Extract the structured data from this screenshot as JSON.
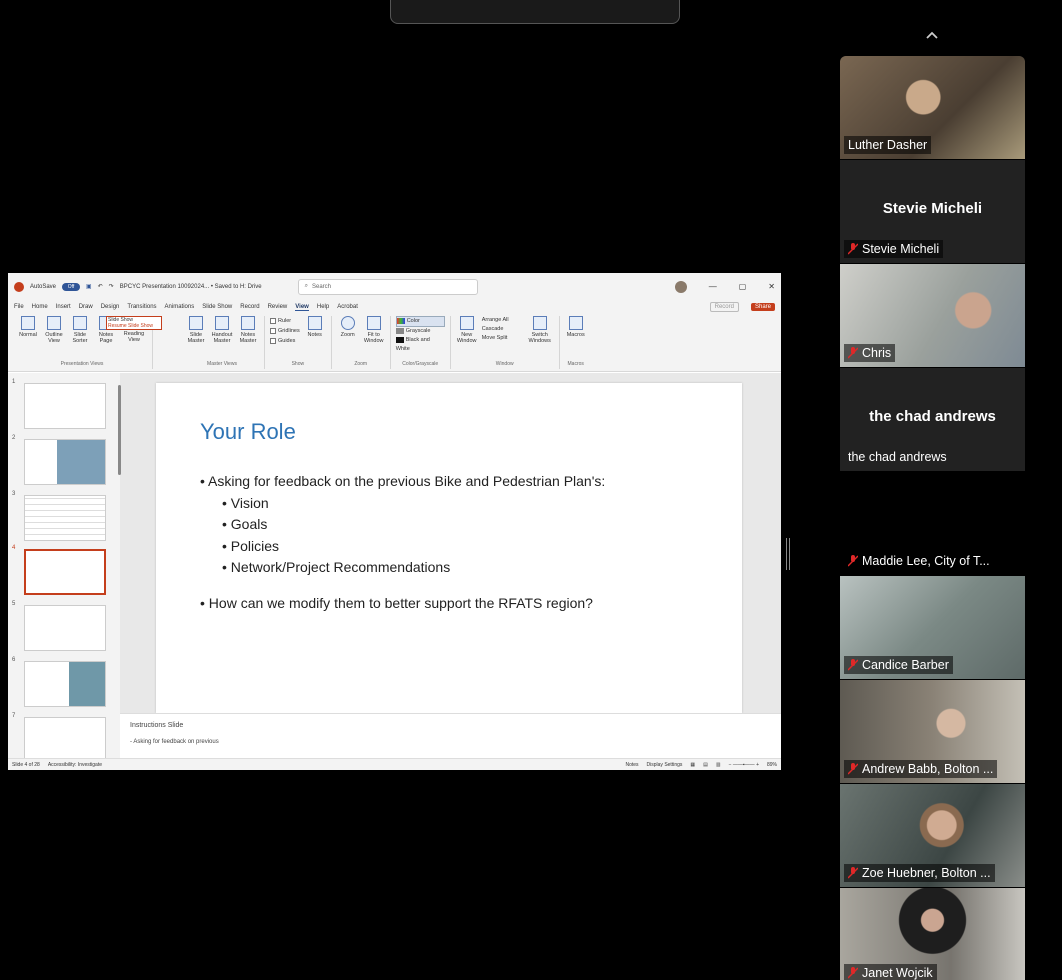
{
  "powerpoint": {
    "autosave": "AutoSave",
    "autosave_state": "Off",
    "doc_title": "BPCYC Presentation 10092024... • Saved to H: Drive",
    "search_placeholder": "Search",
    "menu": [
      "File",
      "Home",
      "Insert",
      "Draw",
      "Design",
      "Transitions",
      "Animations",
      "Slide Show",
      "Record",
      "Review",
      "View",
      "Help",
      "Acrobat"
    ],
    "active_menu": "View",
    "record": "Record",
    "share": "Share",
    "ribbon_groups": [
      {
        "label": "Presentation Views",
        "items": [
          "Normal",
          "Outline View",
          "Slide Sorter",
          "Notes Page",
          "Reading View"
        ]
      },
      {
        "label": "Master Views",
        "items": [
          "Slide Master",
          "Handout Master",
          "Notes Master"
        ]
      },
      {
        "label": "Show",
        "checks": [
          "Ruler",
          "Gridlines",
          "Guides"
        ],
        "items": [
          "Notes"
        ]
      },
      {
        "label": "Zoom",
        "items": [
          "Zoom",
          "Fit to Window"
        ]
      },
      {
        "label": "Color/Grayscale",
        "options": [
          "Color",
          "Grayscale",
          "Black and White"
        ]
      },
      {
        "label": "Window",
        "items": [
          "New Window",
          "Arrange All",
          "Cascade",
          "Move Split",
          "Switch Windows"
        ]
      },
      {
        "label": "Macros",
        "items": [
          "Macros"
        ]
      }
    ],
    "slideshow_drop_1": "Slide Show",
    "slideshow_drop_2": "Resume Slide Show",
    "thumb_numbers": [
      "1",
      "2",
      "3",
      "4",
      "5",
      "6",
      "7"
    ],
    "slide": {
      "title": "Your Role",
      "b1": "Asking for feedback on the previous Bike and Pedestrian Plan's:",
      "s1": "Vision",
      "s2": "Goals",
      "s3": "Policies",
      "s4": "Network/Project Recommendations",
      "b2": "How can we modify them to better support the RFATS region?"
    },
    "notes_title": "Instructions Slide",
    "notes_line": "-  Asking for feedback on previous",
    "status_left": "Slide 4 of 28",
    "accessibility": "Accessibility: Investigate",
    "status_notes": "Notes",
    "display_settings": "Display Settings",
    "zoom_pct": "89%"
  },
  "participants": [
    {
      "name": "Luther Dasher",
      "video": true,
      "muted": false,
      "bg": "#6b5a46"
    },
    {
      "name": "Stevie Micheli",
      "video": false,
      "muted": true,
      "big": "Stevie Micheli"
    },
    {
      "name": "Chris",
      "video": true,
      "muted": true,
      "bg": "#8a8f8c"
    },
    {
      "name": "the chad andrews",
      "video": false,
      "muted": false,
      "big": "the chad andrews"
    },
    {
      "name": "Maddie Lee, City of T...",
      "video": false,
      "muted": true,
      "big": ""
    },
    {
      "name": "Candice Barber",
      "video": true,
      "muted": true,
      "bg": "#7d8a88"
    },
    {
      "name": "Andrew Babb, Bolton ...",
      "video": true,
      "muted": true,
      "bg": "#6f6a62"
    },
    {
      "name": "Zoe Huebner, Bolton ...",
      "video": true,
      "muted": true,
      "bg": "#55605c"
    },
    {
      "name": "Janet Wojcik",
      "video": true,
      "muted": true,
      "bg": "#8c8a84"
    }
  ],
  "colors": {
    "accent": "#c43e1c",
    "slide_title": "#2e74b5",
    "mic_muted": "#e02828"
  }
}
